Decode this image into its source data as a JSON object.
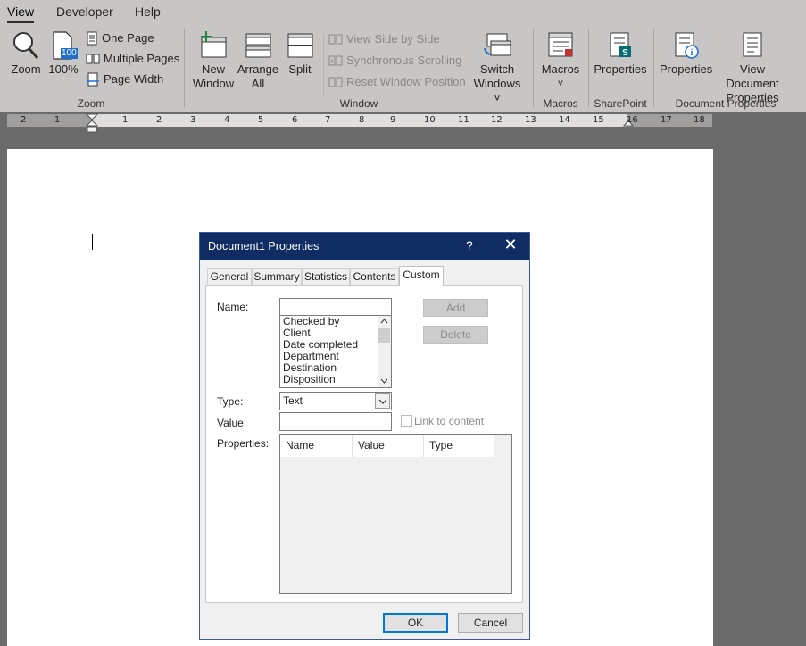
{
  "ribbon": {
    "tabs": [
      {
        "label": "View",
        "active": true
      },
      {
        "label": "Developer",
        "active": false
      },
      {
        "label": "Help",
        "active": false
      }
    ],
    "zoom_group": {
      "label": "Zoom",
      "zoom": "Zoom",
      "zoom_100": "100%",
      "zoom_badge": "100",
      "one_page": "One Page",
      "multiple_pages": "Multiple Pages",
      "page_width": "Page Width"
    },
    "window_group": {
      "label": "Window",
      "new_window_1": "New",
      "new_window_2": "Window",
      "arrange_1": "Arrange",
      "arrange_2": "All",
      "split": "Split",
      "side_by_side": "View Side by Side",
      "sync_scroll": "Synchronous Scrolling",
      "reset_pos": "Reset Window Position",
      "switch_1": "Switch",
      "switch_2": "Windows ˅"
    },
    "macros_group": {
      "label": "Macros",
      "macros": "Macros",
      "chevron": "˅"
    },
    "sharepoint_group": {
      "label": "SharePoint",
      "properties": "Properties"
    },
    "docprops_group": {
      "label": "Document Properties",
      "properties": "Properties",
      "view_doc_1": "View Document",
      "view_doc_2": "Properties"
    }
  },
  "ruler": {
    "labels": [
      "2",
      "1",
      "1",
      "2",
      "3",
      "4",
      "5",
      "6",
      "7",
      "8",
      "9",
      "10",
      "11",
      "12",
      "13",
      "14",
      "15",
      "16",
      "17",
      "18"
    ]
  },
  "dialog": {
    "title": "Document1 Properties",
    "help": "?",
    "close": "✕",
    "tabs": [
      {
        "label": "General",
        "active": false
      },
      {
        "label": "Summary",
        "active": false
      },
      {
        "label": "Statistics",
        "active": false
      },
      {
        "label": "Contents",
        "active": false
      },
      {
        "label": "Custom",
        "active": true
      }
    ],
    "name_label": "Name:",
    "name_value": "",
    "name_options": [
      "Checked by",
      "Client",
      "Date completed",
      "Department",
      "Destination",
      "Disposition"
    ],
    "add_label": "Add",
    "delete_label": "Delete",
    "type_label": "Type:",
    "type_value": "Text",
    "value_label": "Value:",
    "value_value": "",
    "link_label": "Link to content",
    "properties_label": "Properties:",
    "columns": [
      "Name",
      "Value",
      "Type"
    ],
    "ok_label": "OK",
    "cancel_label": "Cancel"
  },
  "colors": {
    "title_bar": "#0f2c63",
    "ribbon_bg": "#c8c6c4",
    "ok_border": "#0078d7",
    "sharepoint_teal": "#036c70"
  }
}
